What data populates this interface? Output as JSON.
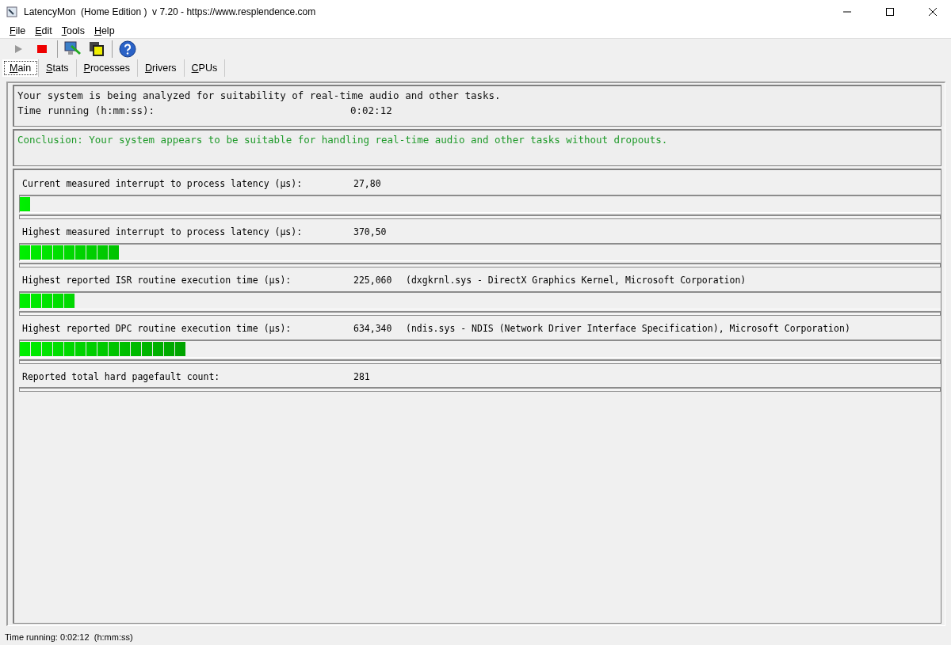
{
  "window": {
    "title": "LatencyMon  (Home Edition )  v 7.20 - https://www.resplendence.com"
  },
  "menu": [
    {
      "label": "File"
    },
    {
      "label": "Edit"
    },
    {
      "label": "Tools"
    },
    {
      "label": "Help"
    }
  ],
  "toolbar": [
    {
      "kind": "play",
      "disabled": true
    },
    {
      "kind": "stop",
      "disabled": false
    },
    {
      "kind": "separator"
    },
    {
      "kind": "monitor"
    },
    {
      "kind": "windows"
    },
    {
      "kind": "separator"
    },
    {
      "kind": "help"
    }
  ],
  "tabs": [
    {
      "label": "Main",
      "selected": true
    },
    {
      "label": "Stats",
      "selected": false
    },
    {
      "label": "Processes",
      "selected": false
    },
    {
      "label": "Drivers",
      "selected": false
    },
    {
      "label": "CPUs",
      "selected": false
    }
  ],
  "status": {
    "message": "Your system is being analyzed for suitability of real-time audio and other tasks.",
    "time_label": "Time running (h:mm:ss):",
    "time_value": "0:02:12"
  },
  "conclusion": "Conclusion: Your system appears to be suitable for handling real-time audio and other tasks without dropouts.",
  "metrics": [
    {
      "label": "Current measured interrupt to process latency (µs):",
      "value": "27,80",
      "level": 0.011
    },
    {
      "label": "Highest measured interrupt to process latency (µs):",
      "value": "370,50",
      "level": 0.108
    },
    {
      "label": "Highest reported ISR routine execution time (µs):",
      "value": "225,060",
      "detail": "(dxgkrnl.sys - DirectX Graphics Kernel, Microsoft Corporation)",
      "level": 0.06
    },
    {
      "label": "Highest reported DPC routine execution time (µs):",
      "value": "634,340",
      "detail": "(ndis.sys - NDIS (Network Driver Interface Specification), Microsoft Corporation)",
      "level": 0.18
    },
    {
      "label": "Reported total hard pagefault count:",
      "value": "281"
    }
  ],
  "status_bar": "Time running: 0:02:12  (h:mm:ss)"
}
